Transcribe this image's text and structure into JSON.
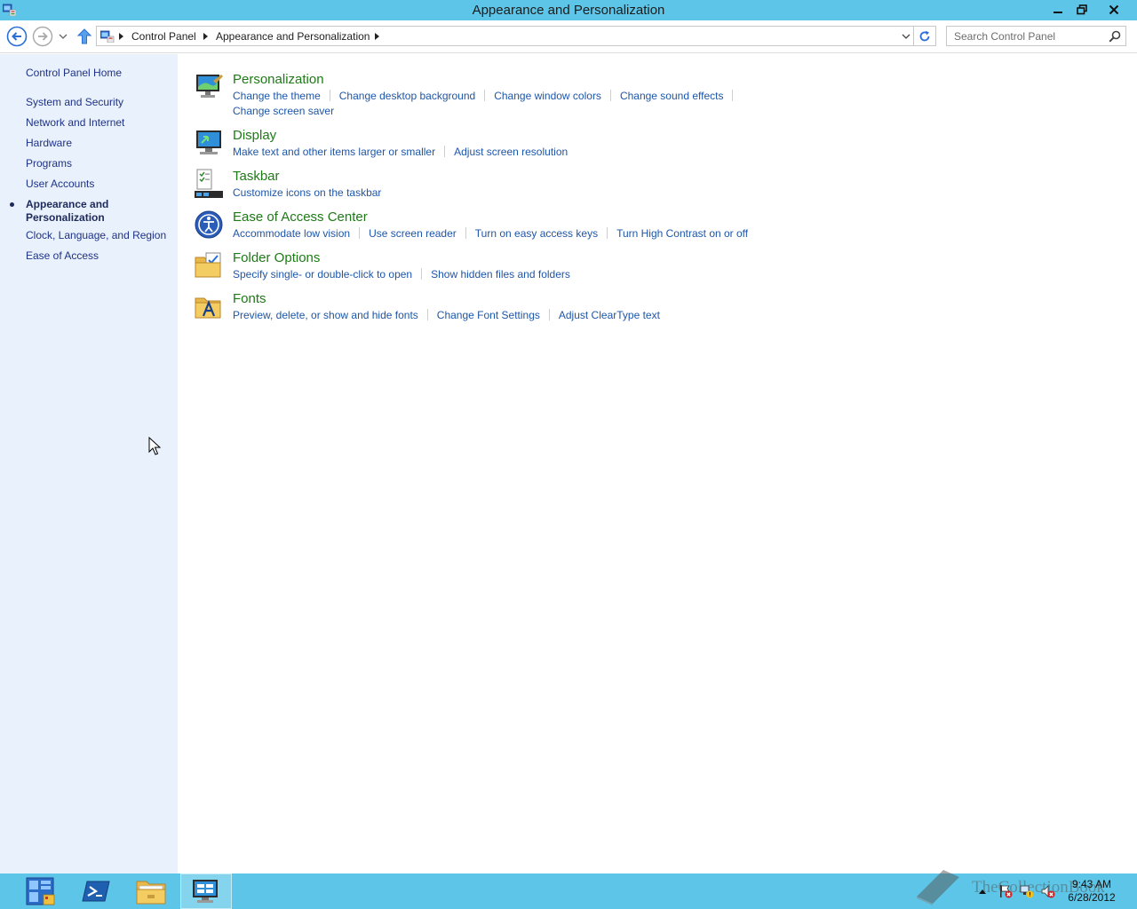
{
  "window": {
    "title": "Appearance and Personalization"
  },
  "address": {
    "crumbs": [
      "Control Panel",
      "Appearance and Personalization"
    ],
    "search_placeholder": "Search Control Panel"
  },
  "sidebar": {
    "home": "Control Panel Home",
    "items": [
      {
        "label": "System and Security"
      },
      {
        "label": "Network and Internet"
      },
      {
        "label": "Hardware"
      },
      {
        "label": "Programs"
      },
      {
        "label": "User Accounts"
      },
      {
        "label": "Appearance and Personalization",
        "current": true
      },
      {
        "label": "Clock, Language, and Region"
      },
      {
        "label": "Ease of Access"
      }
    ]
  },
  "categories": [
    {
      "icon": "personalization-icon",
      "title": "Personalization",
      "links": [
        "Change the theme",
        "Change desktop background",
        "Change window colors",
        "Change sound effects",
        "Change screen saver"
      ]
    },
    {
      "icon": "display-icon",
      "title": "Display",
      "links": [
        "Make text and other items larger or smaller",
        "Adjust screen resolution"
      ]
    },
    {
      "icon": "taskbar-icon",
      "title": "Taskbar",
      "links": [
        "Customize icons on the taskbar"
      ]
    },
    {
      "icon": "ease-of-access-icon",
      "title": "Ease of Access Center",
      "links": [
        "Accommodate low vision",
        "Use screen reader",
        "Turn on easy access keys",
        "Turn High Contrast on or off"
      ]
    },
    {
      "icon": "folder-options-icon",
      "title": "Folder Options",
      "links": [
        "Specify single- or double-click to open",
        "Show hidden files and folders"
      ]
    },
    {
      "icon": "fonts-icon",
      "title": "Fonts",
      "links": [
        "Preview, delete, or show and hide fonts",
        "Change Font Settings",
        "Adjust ClearType text"
      ]
    }
  ],
  "taskbar": {
    "buttons": [
      "server-manager-icon",
      "powershell-icon",
      "file-explorer-icon",
      "control-panel-icon"
    ],
    "clock_time": "9:43 AM",
    "clock_date": "6/28/2012",
    "watermark": "TheCollectionBook"
  },
  "colors": {
    "chrome": "#5dc6e8",
    "sidebar_bg": "#e9f1fc",
    "category_title": "#1d7a16",
    "task_link": "#1e56a8",
    "sidebar_link": "#1e3287"
  }
}
